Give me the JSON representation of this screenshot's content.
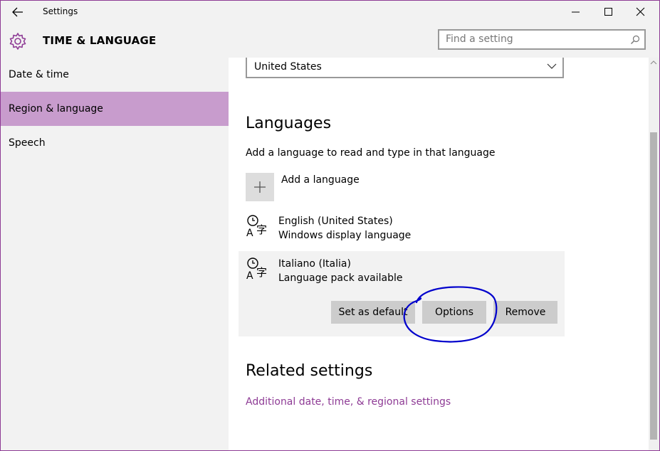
{
  "window": {
    "title": "Settings",
    "accent_color": "#8e3b95",
    "controls": [
      "minimize-icon",
      "maximize-icon",
      "close-icon"
    ]
  },
  "header": {
    "section_title": "TIME & LANGUAGE",
    "icon": "gear-icon",
    "search": {
      "placeholder": "Find a setting",
      "value": "",
      "icon": "search-icon"
    }
  },
  "sidebar": {
    "items": [
      {
        "label": "Date & time",
        "active": false
      },
      {
        "label": "Region & language",
        "active": true
      },
      {
        "label": "Speech",
        "active": false
      }
    ],
    "active_color": "#c89ccd"
  },
  "main": {
    "country_dropdown": {
      "value": "United States",
      "icon": "chevron-down-icon"
    },
    "languages": {
      "heading": "Languages",
      "description": "Add a language to read and type in that language",
      "add_label": "Add a language",
      "add_icon": "plus-icon",
      "items": [
        {
          "name": "English (United States)",
          "status": "Windows display language",
          "icon": "language-icon",
          "selected": false
        },
        {
          "name": "Italiano (Italia)",
          "status": "Language pack available",
          "icon": "language-icon",
          "selected": true
        }
      ],
      "actions": {
        "set_default": "Set as default",
        "options": "Options",
        "remove": "Remove"
      }
    },
    "related": {
      "heading": "Related settings",
      "link": "Additional date, time, & regional settings"
    }
  },
  "annotation": {
    "shape": "hand-drawn circle around Options button",
    "color": "#0000cc"
  }
}
